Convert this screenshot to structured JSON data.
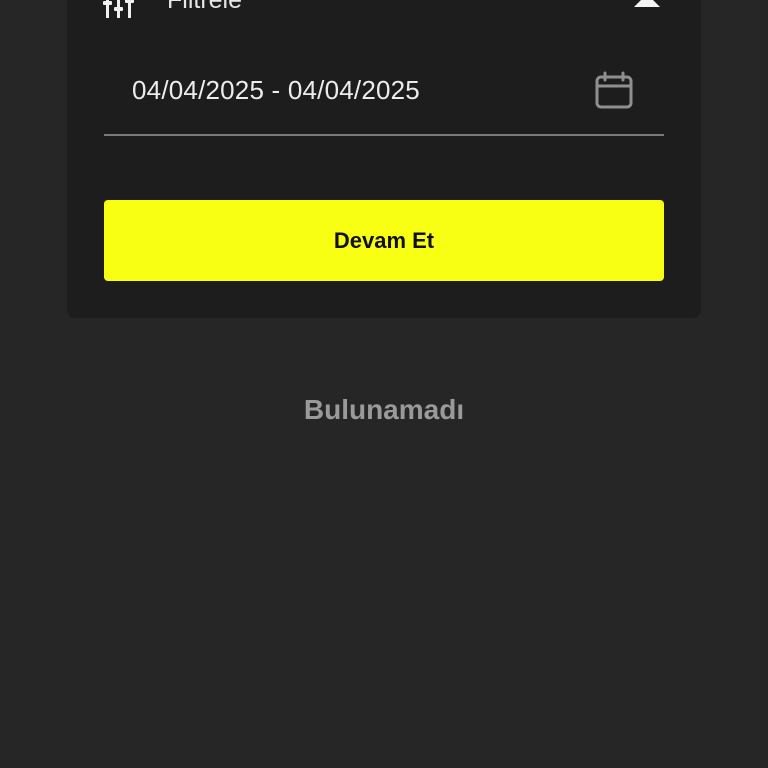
{
  "filter": {
    "title": "Filtrele",
    "filter_icon": "sliders-icon",
    "collapse_icon": "caret-up-icon",
    "date_range": {
      "value": "04/04/2025 - 04/04/2025",
      "calendar_icon": "calendar-icon"
    },
    "continue_label": "Devam Et"
  },
  "results": {
    "empty_message": "Bulunamadı"
  },
  "colors": {
    "background": "#262626",
    "card": "#1d1d1d",
    "accent": "#f9ff12",
    "text": "#ececec",
    "muted": "#9a9a9a"
  }
}
